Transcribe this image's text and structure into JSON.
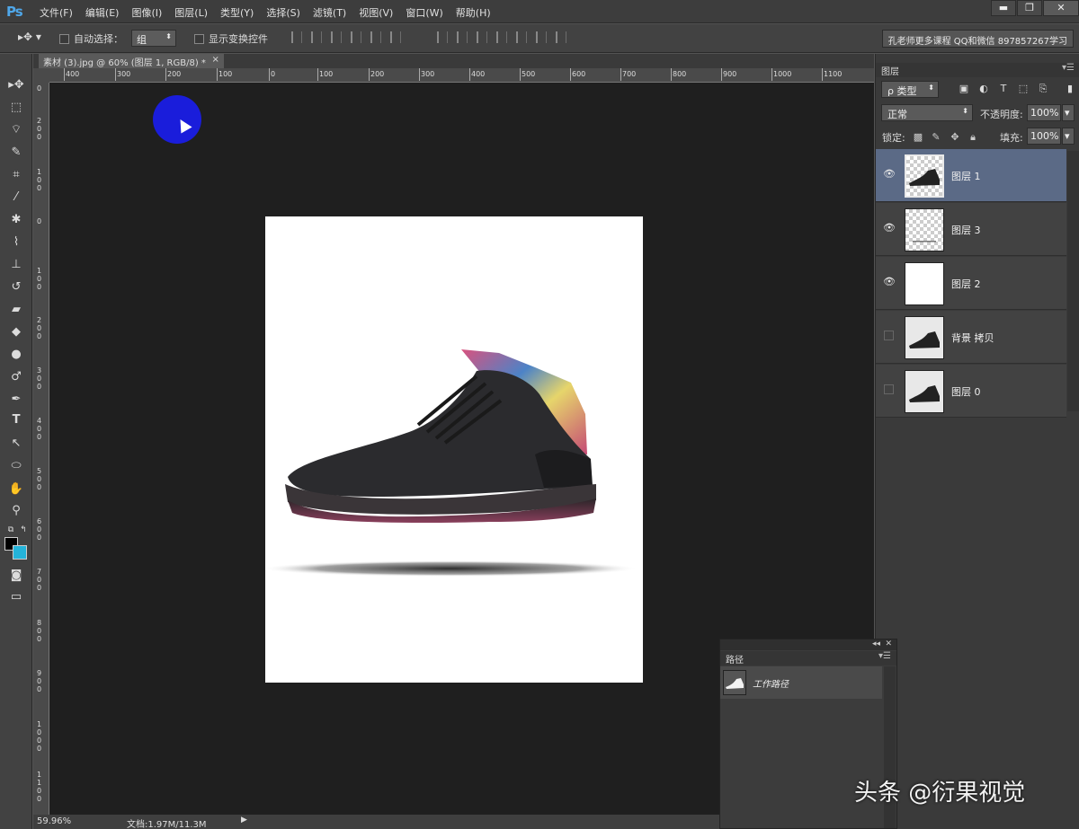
{
  "app": {
    "logo": "Ps",
    "menu": [
      "文件(F)",
      "编辑(E)",
      "图像(I)",
      "图层(L)",
      "类型(Y)",
      "选择(S)",
      "滤镜(T)",
      "视图(V)",
      "窗口(W)",
      "帮助(H)"
    ],
    "window_controls": [
      "▬",
      "❐",
      "✕"
    ]
  },
  "options": {
    "auto_select_label": "自动选择：",
    "auto_select_value": "组",
    "show_transform_label": "显示变换控件",
    "promo": "孔老师更多课程 QQ和微信 897857267学习"
  },
  "document": {
    "tab_title": "素材 (3).jpg @ 60% (图层 1, RGB/8) *",
    "tab_close": "×",
    "zoom": "59.96%",
    "doc_info": "文档:1.97M/11.3M",
    "status_arrow": "▶"
  },
  "rulers": {
    "h_ticks": [
      "400",
      "300",
      "200",
      "100",
      "0",
      "100",
      "200",
      "300",
      "400",
      "500",
      "600",
      "700",
      "800",
      "900",
      "1000",
      "1100"
    ],
    "v_ticks": [
      "0",
      "200",
      "100",
      "0",
      "100",
      "200",
      "300",
      "400",
      "500",
      "600",
      "700",
      "800",
      "900",
      "1000",
      "1100"
    ]
  },
  "layers_panel": {
    "tab": "图层",
    "menu": "▾☰",
    "filter_label": "ρ 类型",
    "blend_mode": "正常",
    "opacity_label": "不透明度:",
    "opacity_value": "100%",
    "lock_label": "锁定:",
    "fill_label": "填充:",
    "fill_value": "100%",
    "layers": [
      {
        "name": "图层 1",
        "visible": true,
        "active": true
      },
      {
        "name": "图层 3",
        "visible": true,
        "active": false
      },
      {
        "name": "图层 2",
        "visible": true,
        "active": false
      },
      {
        "name": "背景 拷贝",
        "visible": false,
        "active": false
      },
      {
        "name": "图层 0",
        "visible": false,
        "active": false
      }
    ]
  },
  "paths_panel": {
    "tab": "路径",
    "menu": "▾☰",
    "collapse": "◂◂",
    "close": "✕",
    "item": "工作路径"
  },
  "watermark": "头条 @衍果视觉"
}
